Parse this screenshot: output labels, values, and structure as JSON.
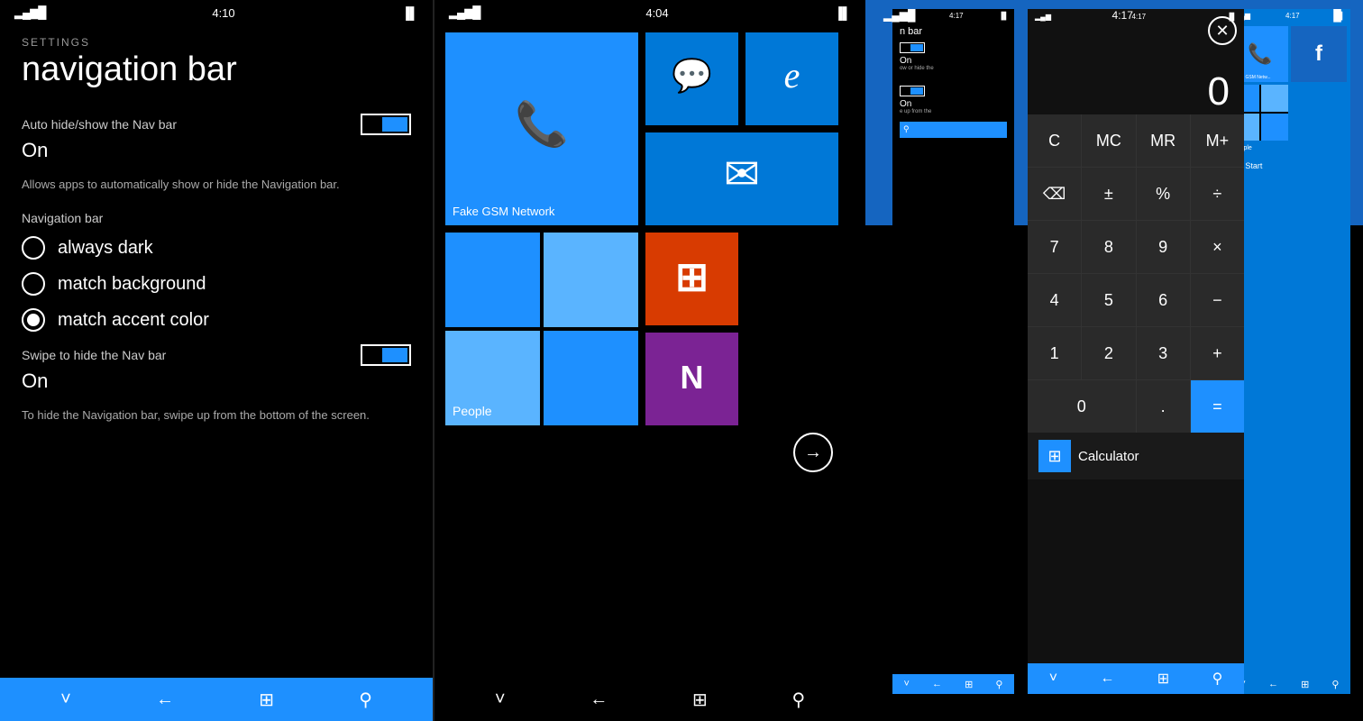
{
  "panel1": {
    "status": {
      "signal": "▂▄▆█",
      "battery_icon": "🔋",
      "time": "4:10"
    },
    "header_label": "SETTINGS",
    "header_title": "navigation bar",
    "auto_hide": {
      "label": "Auto hide/show the Nav bar",
      "value": "On"
    },
    "description1": "Allows apps to automatically show or hide the Navigation bar.",
    "nav_bar_section": "Navigation bar",
    "radio_options": [
      {
        "label": "always dark",
        "selected": false
      },
      {
        "label": "match background",
        "selected": false
      },
      {
        "label": "match accent color",
        "selected": true
      }
    ],
    "swipe_hide": {
      "label": "Swipe to hide the Nav bar",
      "value": "On"
    },
    "description2": "To hide the Navigation bar, swipe up from the bottom of the screen.",
    "bottom_nav": {
      "chevron": "˅",
      "back": "←",
      "windows": "⊞",
      "search": "🔍"
    }
  },
  "panel2": {
    "status": {
      "signal": "▂▄▆█",
      "battery_icon": "🔋",
      "time": "4:04"
    },
    "tiles": {
      "phone_tile_label": "Fake GSM Network",
      "people_tile_label": "People",
      "messaging_icon": "💬",
      "ie_icon": "e",
      "mail_icon": "✉",
      "office_icon": "O",
      "onenote_icon": "N"
    },
    "arrow_label": "→",
    "bottom_nav": {
      "chevron": "˅",
      "back": "←",
      "windows": "⊞",
      "search": "🔍"
    }
  },
  "panel3": {
    "status_time": "4:17",
    "mini_settings": {
      "title": "n bar",
      "toggle_label": "ow or hide the",
      "toggle_value": "On"
    },
    "calculator": {
      "display": "0",
      "buttons": [
        [
          "C",
          "MC",
          "MR",
          "M+"
        ],
        [
          "⌫",
          "±",
          "%",
          "÷"
        ],
        [
          "7",
          "8",
          "9",
          "×"
        ],
        [
          "4",
          "5",
          "6",
          "−"
        ],
        [
          "1",
          "2",
          "3",
          "+"
        ],
        [
          "0",
          ".",
          "=",
          "="
        ]
      ],
      "app_label": "Calculator"
    },
    "start_phone": {
      "app_label": "Start"
    }
  }
}
